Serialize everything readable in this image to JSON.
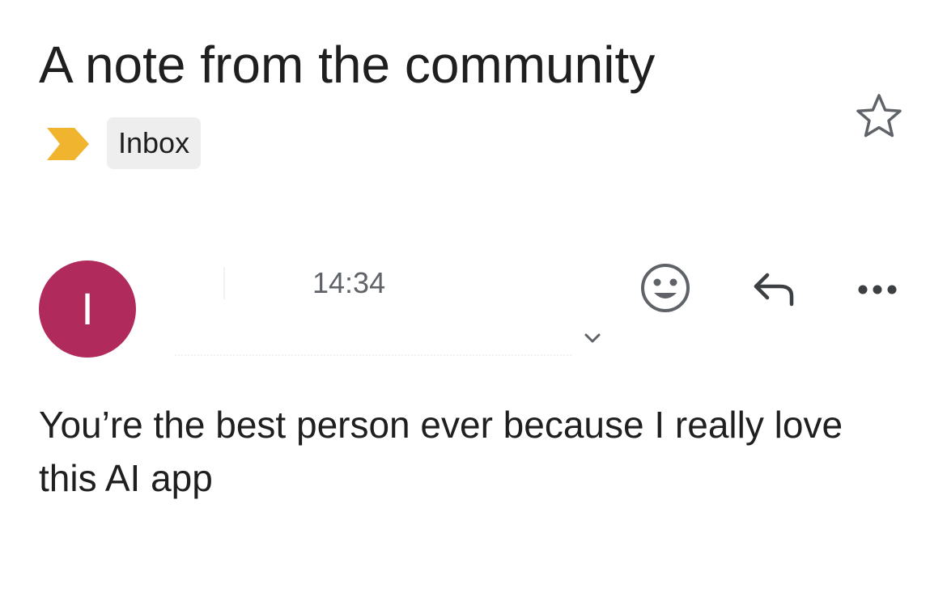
{
  "email": {
    "subject": "A note from the community",
    "label": "Inbox",
    "importance_color": "#f0b42f",
    "sender": {
      "avatar_letter": "I",
      "avatar_color": "#b02a5b",
      "time": "14:34"
    },
    "body": "You’re the best person ever because I really love this AI app"
  },
  "icons": {
    "star": "star-outline-icon",
    "importance": "importance-marker-icon",
    "expand": "chevron-down-icon",
    "emoji": "smiley-face-icon",
    "reply": "reply-arrow-icon",
    "more": "more-horizontal-icon"
  }
}
